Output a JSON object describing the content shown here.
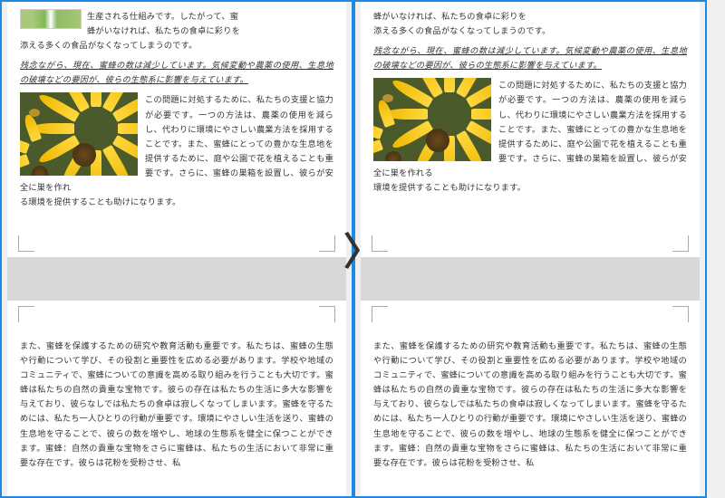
{
  "left": {
    "top": {
      "para1_a": "生産される仕組みです。したがって、蜜",
      "para1_b": "蜂がいなければ、私たちの食卓に彩りを",
      "para1_c": "添える多くの食品がなくなってしまうのです。",
      "para2": "残念ながら、現在、蜜蜂の数は減少しています。気候変動や農薬の使用、生息地の破壊などの要因が、彼らの生態系に影響を与えています。",
      "para3": "この問題に対処するために、私たちの支援と協力が必要です。一つの方法は、農薬の使用を減らし、代わりに環境にやさしい農業方法を採用することです。また、蜜蜂にとっての豊かな生息地を提供するために、庭や公園で花を植えることも重要です。さらに、蜜蜂の巣箱を設置し、彼らが安全に巣を作れ",
      "para3_tail": "る環境を提供することも助けになります。"
    },
    "bottom": {
      "para4": "また、蜜蜂を保護するための研究や教育活動も重要です。私たちは、蜜蜂の生態や行動について学び、その役割と重要性を広める必要があります。学校や地域のコミュニティで、蜜蜂についての意識を高める取り組みを行うことも大切です。蜜蜂は私たちの自然の貴重な宝物です。彼らの存在は私たちの生活に多大な影響を与えており、彼らなしでは私たちの食卓は寂しくなってしまいます。蜜蜂を守るためには、私たち一人ひとりの行動が重要です。環境にやさしい生活を送り、蜜蜂の生息地を守ることで、彼らの数を増やし、地球の生態系を健全に保つことができます。蜜蜂：自然の貴重な宝物をさらに蜜蜂は、私たちの生活において非常に重要な存在です。彼らは花粉を受粉させ、私"
    }
  },
  "right": {
    "top": {
      "para1_b": "蜂がいなければ、私たちの食卓に彩りを",
      "para1_c": "添える多くの食品がなくなってしまうのです。",
      "para2": "残念ながら、現在、蜜蜂の数は減少しています。気候変動や農薬の使用、生息地の破壊などの要因が、彼らの生態系に影響を与えています。",
      "para3": "この問題に対処するために、私たちの支援と協力が必要です。一つの方法は、農薬の使用を減らし、代わりに環境にやさしい農業方法を採用することです。また、蜜蜂にとっての豊かな生息地を提供するために、庭や公園で花を植えることも重要です。さらに、蜜蜂の巣箱を設置し、彼らが安全に巣を作れる",
      "para3_tail": "環境を提供することも助けになります。"
    },
    "bottom": {
      "para4": "また、蜜蜂を保護するための研究や教育活動も重要です。私たちは、蜜蜂の生態や行動について学び、その役割と重要性を広める必要があります。学校や地域のコミュニティで、蜜蜂についての意識を高める取り組みを行うことも大切です。蜜蜂は私たちの自然の貴重な宝物です。彼らの存在は私たちの生活に多大な影響を与えており、彼らなしでは私たちの食卓は寂しくなってしまいます。蜜蜂を守るためには、私たち一人ひとりの行動が重要です。環境にやさしい生活を送り、蜜蜂の生息地を守ることで、彼らの数を増やし、地球の生態系を健全に保つことができます。蜜蜂：自然の貴重な宝物をさらに蜜蜂は、私たちの生活において非常に重要な存在です。彼らは花粉を受粉させ、私"
    }
  },
  "arrow": "〉"
}
